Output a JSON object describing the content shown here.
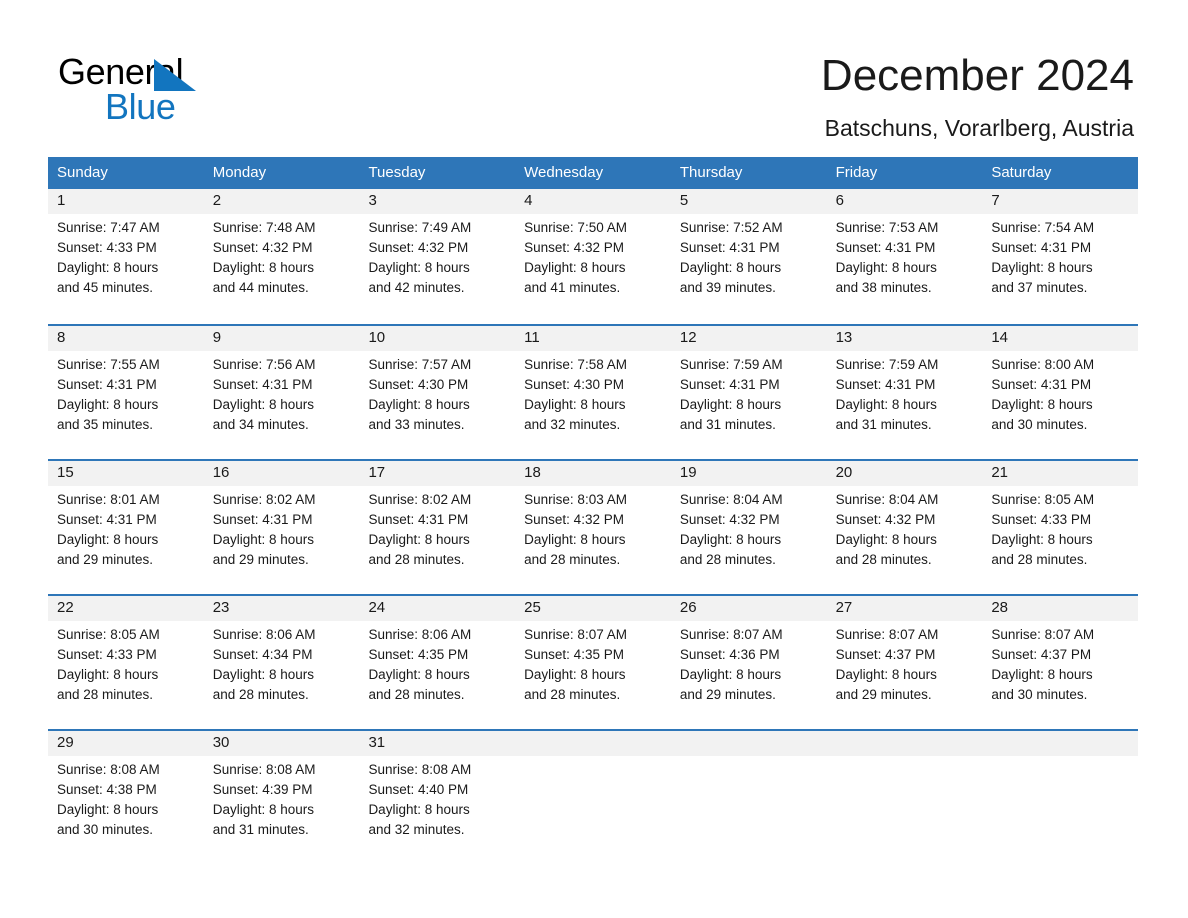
{
  "brand": {
    "name_top": "General",
    "name_bottom": "Blue",
    "triangle_icon": "blue-triangle-icon",
    "accent_color": "#1275bf"
  },
  "header": {
    "title": "December 2024",
    "location": "Batschuns, Vorarlberg, Austria"
  },
  "theme": {
    "header_bg": "#2e76b8",
    "header_text": "#ffffff",
    "row_band_bg": "#f2f2f2",
    "row_divider": "#2e76b8",
    "body_text": "#1a1a1a"
  },
  "calendar": {
    "weekday_headers": [
      "Sunday",
      "Monday",
      "Tuesday",
      "Wednesday",
      "Thursday",
      "Friday",
      "Saturday"
    ],
    "labels": {
      "sunrise": "Sunrise:",
      "sunset": "Sunset:",
      "daylight": "Daylight:"
    },
    "weeks": [
      {
        "days": [
          {
            "num": "1",
            "l1": "Sunrise: 7:47 AM",
            "l2": "Sunset: 4:33 PM",
            "l3": "Daylight: 8 hours",
            "l4": "and 45 minutes."
          },
          {
            "num": "2",
            "l1": "Sunrise: 7:48 AM",
            "l2": "Sunset: 4:32 PM",
            "l3": "Daylight: 8 hours",
            "l4": "and 44 minutes."
          },
          {
            "num": "3",
            "l1": "Sunrise: 7:49 AM",
            "l2": "Sunset: 4:32 PM",
            "l3": "Daylight: 8 hours",
            "l4": "and 42 minutes."
          },
          {
            "num": "4",
            "l1": "Sunrise: 7:50 AM",
            "l2": "Sunset: 4:32 PM",
            "l3": "Daylight: 8 hours",
            "l4": "and 41 minutes."
          },
          {
            "num": "5",
            "l1": "Sunrise: 7:52 AM",
            "l2": "Sunset: 4:31 PM",
            "l3": "Daylight: 8 hours",
            "l4": "and 39 minutes."
          },
          {
            "num": "6",
            "l1": "Sunrise: 7:53 AM",
            "l2": "Sunset: 4:31 PM",
            "l3": "Daylight: 8 hours",
            "l4": "and 38 minutes."
          },
          {
            "num": "7",
            "l1": "Sunrise: 7:54 AM",
            "l2": "Sunset: 4:31 PM",
            "l3": "Daylight: 8 hours",
            "l4": "and 37 minutes."
          }
        ]
      },
      {
        "days": [
          {
            "num": "8",
            "l1": "Sunrise: 7:55 AM",
            "l2": "Sunset: 4:31 PM",
            "l3": "Daylight: 8 hours",
            "l4": "and 35 minutes."
          },
          {
            "num": "9",
            "l1": "Sunrise: 7:56 AM",
            "l2": "Sunset: 4:31 PM",
            "l3": "Daylight: 8 hours",
            "l4": "and 34 minutes."
          },
          {
            "num": "10",
            "l1": "Sunrise: 7:57 AM",
            "l2": "Sunset: 4:30 PM",
            "l3": "Daylight: 8 hours",
            "l4": "and 33 minutes."
          },
          {
            "num": "11",
            "l1": "Sunrise: 7:58 AM",
            "l2": "Sunset: 4:30 PM",
            "l3": "Daylight: 8 hours",
            "l4": "and 32 minutes."
          },
          {
            "num": "12",
            "l1": "Sunrise: 7:59 AM",
            "l2": "Sunset: 4:31 PM",
            "l3": "Daylight: 8 hours",
            "l4": "and 31 minutes."
          },
          {
            "num": "13",
            "l1": "Sunrise: 7:59 AM",
            "l2": "Sunset: 4:31 PM",
            "l3": "Daylight: 8 hours",
            "l4": "and 31 minutes."
          },
          {
            "num": "14",
            "l1": "Sunrise: 8:00 AM",
            "l2": "Sunset: 4:31 PM",
            "l3": "Daylight: 8 hours",
            "l4": "and 30 minutes."
          }
        ]
      },
      {
        "days": [
          {
            "num": "15",
            "l1": "Sunrise: 8:01 AM",
            "l2": "Sunset: 4:31 PM",
            "l3": "Daylight: 8 hours",
            "l4": "and 29 minutes."
          },
          {
            "num": "16",
            "l1": "Sunrise: 8:02 AM",
            "l2": "Sunset: 4:31 PM",
            "l3": "Daylight: 8 hours",
            "l4": "and 29 minutes."
          },
          {
            "num": "17",
            "l1": "Sunrise: 8:02 AM",
            "l2": "Sunset: 4:31 PM",
            "l3": "Daylight: 8 hours",
            "l4": "and 28 minutes."
          },
          {
            "num": "18",
            "l1": "Sunrise: 8:03 AM",
            "l2": "Sunset: 4:32 PM",
            "l3": "Daylight: 8 hours",
            "l4": "and 28 minutes."
          },
          {
            "num": "19",
            "l1": "Sunrise: 8:04 AM",
            "l2": "Sunset: 4:32 PM",
            "l3": "Daylight: 8 hours",
            "l4": "and 28 minutes."
          },
          {
            "num": "20",
            "l1": "Sunrise: 8:04 AM",
            "l2": "Sunset: 4:32 PM",
            "l3": "Daylight: 8 hours",
            "l4": "and 28 minutes."
          },
          {
            "num": "21",
            "l1": "Sunrise: 8:05 AM",
            "l2": "Sunset: 4:33 PM",
            "l3": "Daylight: 8 hours",
            "l4": "and 28 minutes."
          }
        ]
      },
      {
        "days": [
          {
            "num": "22",
            "l1": "Sunrise: 8:05 AM",
            "l2": "Sunset: 4:33 PM",
            "l3": "Daylight: 8 hours",
            "l4": "and 28 minutes."
          },
          {
            "num": "23",
            "l1": "Sunrise: 8:06 AM",
            "l2": "Sunset: 4:34 PM",
            "l3": "Daylight: 8 hours",
            "l4": "and 28 minutes."
          },
          {
            "num": "24",
            "l1": "Sunrise: 8:06 AM",
            "l2": "Sunset: 4:35 PM",
            "l3": "Daylight: 8 hours",
            "l4": "and 28 minutes."
          },
          {
            "num": "25",
            "l1": "Sunrise: 8:07 AM",
            "l2": "Sunset: 4:35 PM",
            "l3": "Daylight: 8 hours",
            "l4": "and 28 minutes."
          },
          {
            "num": "26",
            "l1": "Sunrise: 8:07 AM",
            "l2": "Sunset: 4:36 PM",
            "l3": "Daylight: 8 hours",
            "l4": "and 29 minutes."
          },
          {
            "num": "27",
            "l1": "Sunrise: 8:07 AM",
            "l2": "Sunset: 4:37 PM",
            "l3": "Daylight: 8 hours",
            "l4": "and 29 minutes."
          },
          {
            "num": "28",
            "l1": "Sunrise: 8:07 AM",
            "l2": "Sunset: 4:37 PM",
            "l3": "Daylight: 8 hours",
            "l4": "and 30 minutes."
          }
        ]
      },
      {
        "days": [
          {
            "num": "29",
            "l1": "Sunrise: 8:08 AM",
            "l2": "Sunset: 4:38 PM",
            "l3": "Daylight: 8 hours",
            "l4": "and 30 minutes."
          },
          {
            "num": "30",
            "l1": "Sunrise: 8:08 AM",
            "l2": "Sunset: 4:39 PM",
            "l3": "Daylight: 8 hours",
            "l4": "and 31 minutes."
          },
          {
            "num": "31",
            "l1": "Sunrise: 8:08 AM",
            "l2": "Sunset: 4:40 PM",
            "l3": "Daylight: 8 hours",
            "l4": "and 32 minutes."
          },
          {
            "num": "",
            "l1": "",
            "l2": "",
            "l3": "",
            "l4": ""
          },
          {
            "num": "",
            "l1": "",
            "l2": "",
            "l3": "",
            "l4": ""
          },
          {
            "num": "",
            "l1": "",
            "l2": "",
            "l3": "",
            "l4": ""
          },
          {
            "num": "",
            "l1": "",
            "l2": "",
            "l3": "",
            "l4": ""
          }
        ]
      }
    ]
  }
}
